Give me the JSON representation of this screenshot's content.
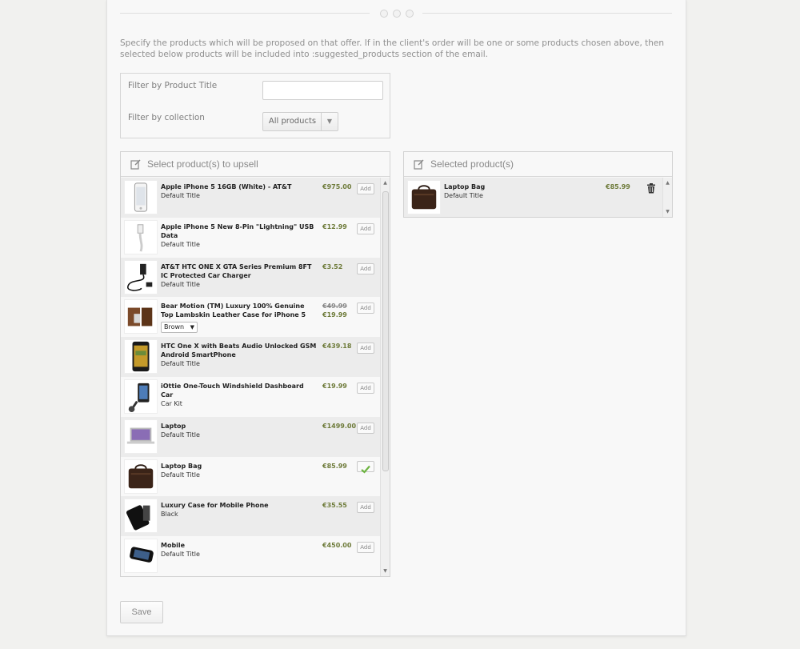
{
  "description": "Specify the products which will be proposed on that offer. If in the client's order will be one or some products chosen above, then selected below products will be included into :suggested_products section of the email.",
  "filters": {
    "title_label": "Filter by Product Title",
    "title_value": "",
    "collection_label": "Filter by collection",
    "collection_value": "All products"
  },
  "upsell_panel": {
    "heading": "Select product(s) to upsell",
    "add_label": "Add",
    "products": [
      {
        "title": "Apple iPhone 5 16GB (White) - AT&T",
        "variant": "Default Title",
        "price": "€975.00",
        "icon": "iphone-white"
      },
      {
        "title": "Apple iPhone 5 New 8-Pin \"Lightning\" USB Data",
        "variant": "Default Title",
        "price": "€12.99",
        "icon": "usb-cable"
      },
      {
        "title": "AT&T HTC ONE X GTA Series Premium 8FT IC Protected Car Charger",
        "variant": "Default Title",
        "price": "€3.52",
        "icon": "car-charger"
      },
      {
        "title": "Bear Motion (TM) Luxury 100% Genuine Top Lambskin Leather Case for iPhone 5",
        "variant": "Brown",
        "old_price": "€49.99",
        "price": "€19.99",
        "icon": "leather-case"
      },
      {
        "title": "HTC One X with Beats Audio Unlocked GSM Android SmartPhone",
        "variant": "Default Title",
        "price": "€439.18",
        "icon": "htc-phone"
      },
      {
        "title": "iOttie One-Touch Windshield Dashboard Car",
        "variant": "Car Kit",
        "price": "€19.99",
        "icon": "car-mount"
      },
      {
        "title": "Laptop",
        "variant": "Default Title",
        "price": "€1499.00",
        "icon": "laptop"
      },
      {
        "title": "Laptop Bag",
        "variant": "Default Title",
        "price": "€85.99",
        "icon": "laptop-bag",
        "selected": true
      },
      {
        "title": "Luxury Case for Mobile Phone",
        "variant": "Black",
        "price": "€35.55",
        "icon": "phone-case"
      },
      {
        "title": "Mobile",
        "variant": "Default Title",
        "price": "€450.00",
        "icon": "mobile"
      }
    ]
  },
  "selected_panel": {
    "heading": "Selected product(s)",
    "products": [
      {
        "title": "Laptop Bag",
        "variant": "Default Title",
        "price": "€85.99",
        "icon": "laptop-bag"
      }
    ]
  },
  "save_label": "Save",
  "colors": {
    "price": "#6e7b3a",
    "check": "#6cb33f"
  }
}
